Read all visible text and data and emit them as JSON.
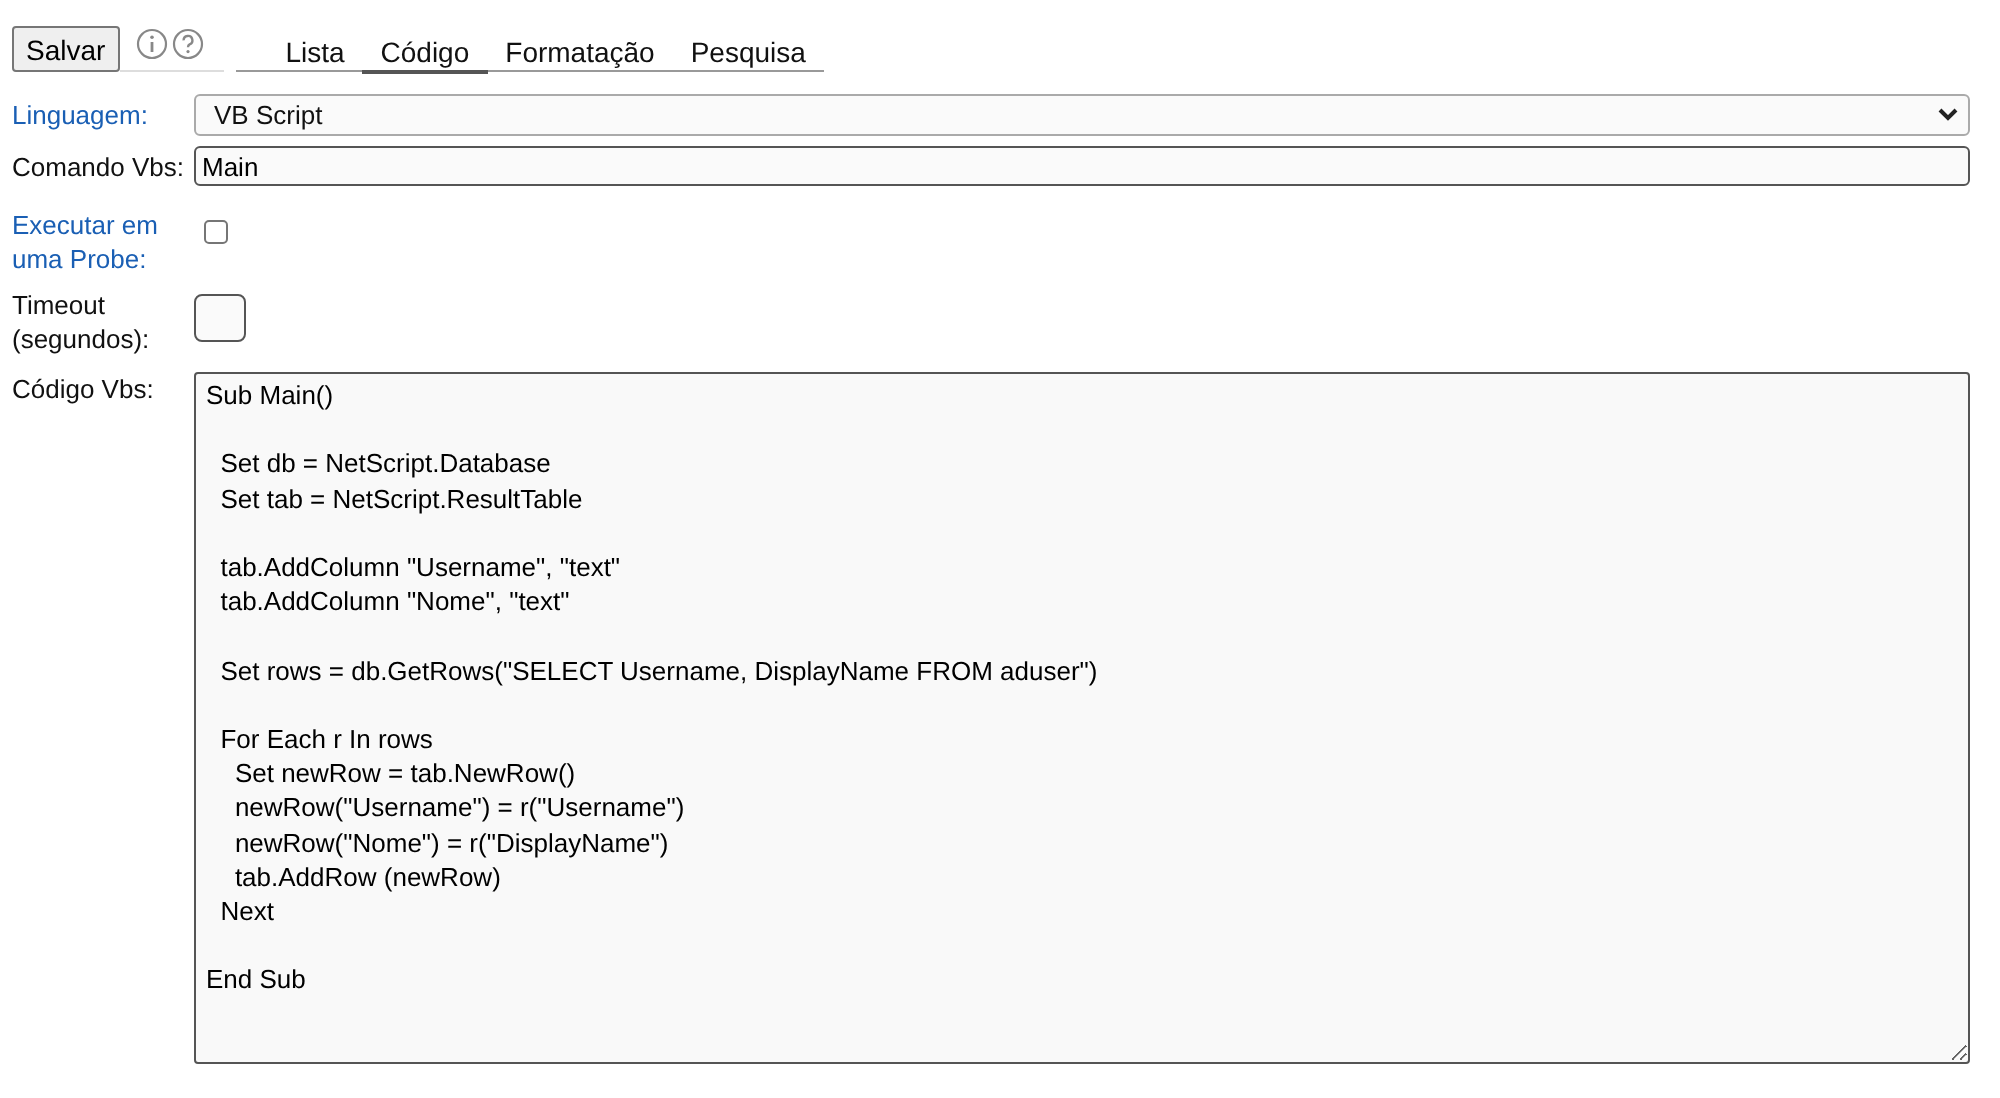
{
  "toolbar": {
    "save_button": "Salvar"
  },
  "tabs": [
    {
      "label": "Lista",
      "selected": false
    },
    {
      "label": "Código",
      "selected": true
    },
    {
      "label": "Formatação",
      "selected": false
    },
    {
      "label": "Pesquisa",
      "selected": false
    }
  ],
  "form": {
    "language": {
      "label": "Linguagem:",
      "value": "VB Script"
    },
    "command": {
      "label": "Comando Vbs:",
      "value": "Main"
    },
    "run_on_probe": {
      "label": "Executar em uma Probe:",
      "checked": false
    },
    "timeout": {
      "label": "Timeout (segundos):"
    },
    "code": {
      "label": "Código Vbs:",
      "value": "Sub Main()\n\n  Set db = NetScript.Database\n  Set tab = NetScript.ResultTable\n\n  tab.AddColumn \"Username\", \"text\"\n  tab.AddColumn \"Nome\", \"text\"\n\n  Set rows = db.GetRows(\"SELECT Username, DisplayName FROM aduser\")\n\n  For Each r In rows\n    Set newRow = tab.NewRow()\n    newRow(\"Username\") = r(\"Username\")\n    newRow(\"Nome\") = r(\"DisplayName\")\n    tab.AddRow (newRow)\n  Next\n\nEnd Sub"
    }
  }
}
